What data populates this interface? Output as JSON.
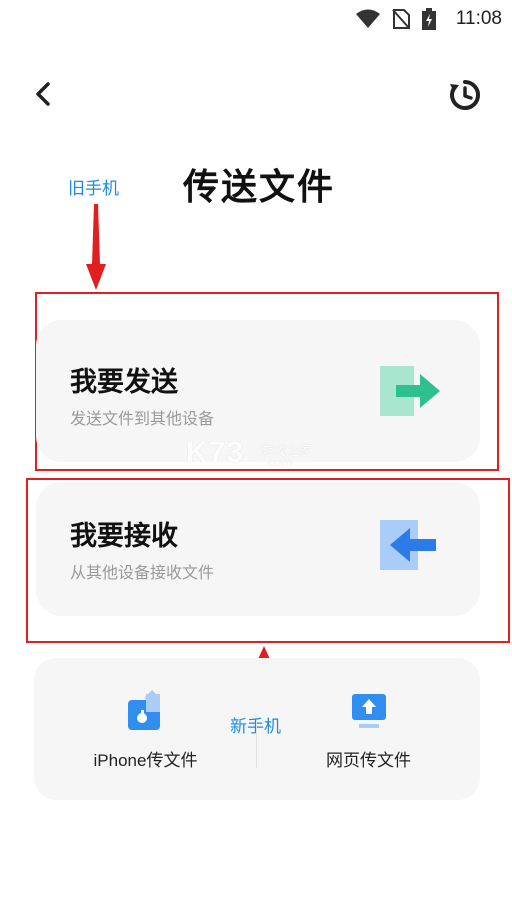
{
  "status_bar": {
    "time": "11:08"
  },
  "page": {
    "title": "传送文件"
  },
  "annotations": {
    "old_phone": "旧手机",
    "new_phone": "新手机"
  },
  "send_card": {
    "title": "我要发送",
    "subtitle": "发送文件到其他设备"
  },
  "receive_card": {
    "title": "我要接收",
    "subtitle": "从其他设备接收文件"
  },
  "bottom": {
    "iphone_label": "iPhone传文件",
    "web_label": "网页传文件"
  },
  "watermark": {
    "brand": "K73",
    "tagline": "游戏之家",
    "domain": ".com"
  },
  "colors": {
    "annotation_blue": "#1e8be0",
    "highlight_red": "#e02020",
    "send_green": "#2ec08f",
    "receive_blue": "#2d7be8",
    "card_bg": "#f6f6f6"
  },
  "icons": {
    "back": "chevron-left-icon",
    "history": "history-clock-icon",
    "send": "send-arrow-icon",
    "receive": "receive-arrow-icon",
    "iphone": "iphone-transfer-icon",
    "web": "web-upload-icon"
  }
}
